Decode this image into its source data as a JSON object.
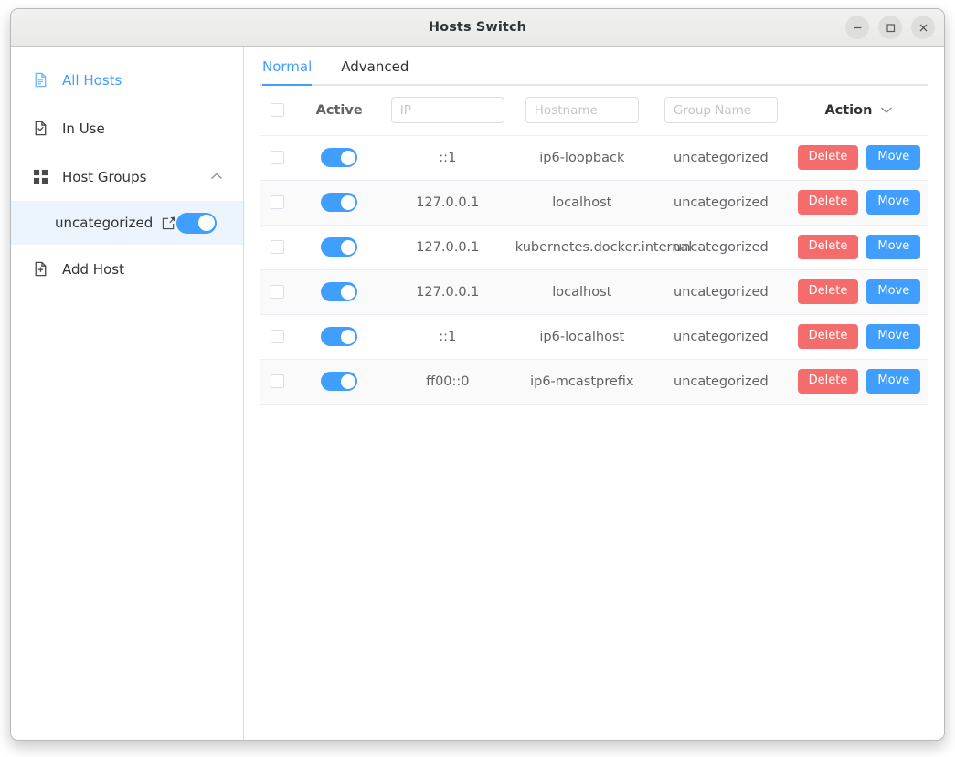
{
  "window": {
    "title": "Hosts Switch",
    "controls": [
      {
        "name": "minimize",
        "glyph": "–"
      },
      {
        "name": "maximize",
        "glyph": "□"
      },
      {
        "name": "close",
        "glyph": "×"
      }
    ]
  },
  "sidebar": {
    "items": [
      {
        "label": "All Hosts",
        "icon": "document-icon",
        "active": true
      },
      {
        "label": "In Use",
        "icon": "document-check-icon",
        "active": false
      },
      {
        "label": "Host Groups",
        "icon": "grid-icon",
        "active": false,
        "expanded": true,
        "chevron": "chevron-up-icon"
      },
      {
        "label": "Add Host",
        "icon": "document-plus-icon",
        "active": false
      }
    ],
    "group": {
      "label": "uncategorized",
      "edit_icon": "edit-icon",
      "enabled": true
    }
  },
  "main": {
    "tabs": [
      {
        "label": "Normal",
        "active": true
      },
      {
        "label": "Advanced",
        "active": false
      }
    ],
    "table": {
      "headers": {
        "select_all": "",
        "active": "Active",
        "ip_placeholder": "IP",
        "ip_value": "",
        "hostname_placeholder": "Hostname",
        "hostname_value": "",
        "group_placeholder": "Group Name",
        "group_value": "",
        "action": "Action",
        "action_chevron": "chevron-down-icon"
      },
      "buttons": {
        "delete": "Delete",
        "move": "Move"
      },
      "rows": [
        {
          "selected": false,
          "active": true,
          "ip": "::1",
          "hostname": "ip6-loopback",
          "group": "uncategorized"
        },
        {
          "selected": false,
          "active": true,
          "ip": "127.0.0.1",
          "hostname": "localhost",
          "group": "uncategorized"
        },
        {
          "selected": false,
          "active": true,
          "ip": "127.0.0.1",
          "hostname": "kubernetes.docker.internal",
          "group": "uncategorized"
        },
        {
          "selected": false,
          "active": true,
          "ip": "127.0.0.1",
          "hostname": "localhost",
          "group": "uncategorized"
        },
        {
          "selected": false,
          "active": true,
          "ip": "::1",
          "hostname": "ip6-localhost",
          "group": "uncategorized"
        },
        {
          "selected": false,
          "active": true,
          "ip": "ff00::0",
          "hostname": "ip6-mcastprefix",
          "group": "uncategorized"
        }
      ]
    }
  },
  "colors": {
    "accent": "#409eff",
    "danger": "#f56c6c",
    "selected_row_bg": "#ecf5fd",
    "alt_row_bg": "#fafafa",
    "border": "#ebeef5"
  }
}
